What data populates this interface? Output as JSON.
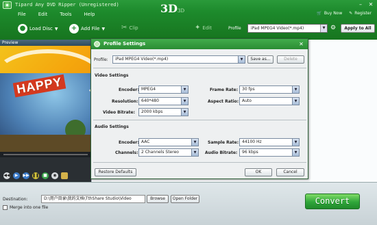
{
  "app": {
    "title": "Tipard Any DVD Ripper (Unregistered)",
    "menu": [
      "File",
      "Edit",
      "Tools",
      "Help"
    ],
    "buy_now": "Buy Now",
    "register": "Register"
  },
  "toolbar": {
    "load_disc": "Load Disc",
    "add_file": "Add File",
    "clip": "Clip",
    "three_d": "3D",
    "three_d_small": "3D",
    "edit": "Edit",
    "profile_label": "Profile",
    "profile_value": "iPad MPEG4 Video(*.mp4)",
    "apply_all": "Apply to All"
  },
  "preview": {
    "header": "Preview",
    "video_banner": "HAPPY"
  },
  "bottom": {
    "destination_label": "Destination:",
    "destination_value": "D:\\用户目录\\我的文档\\TthShare Studio\\Video",
    "browse": "Browse",
    "open_folder": "Open Folder",
    "merge_label": "Merge into one file",
    "convert": "Convert"
  },
  "dialog": {
    "title": "Profile Settings",
    "profile_label": "Profile:",
    "profile_value": "iPad MPEG4 Video(*.mp4)",
    "save_as": "Save as...",
    "delete": "Delete",
    "video_settings": "Video Settings",
    "audio_settings": "Audio Settings",
    "video": {
      "encoder_label": "Encoder:",
      "encoder_value": "MPEG4",
      "resolution_label": "Resolution:",
      "resolution_value": "640*480",
      "video_bitrate_label": "Video Bitrate:",
      "video_bitrate_value": "2000 kbps",
      "frame_rate_label": "Frame Rate:",
      "frame_rate_value": "30 fps",
      "aspect_ratio_label": "Aspect Ratio:",
      "aspect_ratio_value": "Auto"
    },
    "audio": {
      "encoder_label": "Encoder:",
      "encoder_value": "AAC",
      "channels_label": "Channels:",
      "channels_value": "2 Channels Stereo",
      "sample_rate_label": "Sample Rate:",
      "sample_rate_value": "44100 Hz",
      "audio_bitrate_label": "Audio Bitrate:",
      "audio_bitrate_value": "96 kbps"
    },
    "restore_defaults": "Restore Defaults",
    "ok": "OK",
    "cancel": "Cancel"
  },
  "icons": {
    "load_disc": "disc-icon",
    "add_file": "add-file-icon",
    "clip": "scissors-icon",
    "edit": "wand-icon"
  },
  "colors": {
    "brand_green": "#1d8a2c",
    "convert_green": "#2fa53a"
  }
}
